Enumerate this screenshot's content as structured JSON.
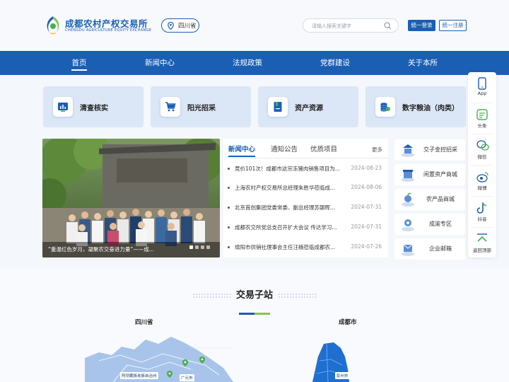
{
  "header": {
    "logo_cn": "成都农村产权交易所",
    "logo_en": "CHENGDU AGRICULTURE EQUITY EXCHANGE",
    "region": "四川省",
    "search_placeholder": "请输入搜索关键字",
    "login_label": "统一登录",
    "register_label": "统一注册"
  },
  "nav": {
    "items": [
      {
        "label": "首页",
        "active": true
      },
      {
        "label": "新闻中心"
      },
      {
        "label": "法规政策"
      },
      {
        "label": "党群建设"
      },
      {
        "label": "关于本所"
      }
    ]
  },
  "features": [
    {
      "label": "清查核实",
      "icon": "chart-icon"
    },
    {
      "label": "阳光招采",
      "icon": "cart-icon"
    },
    {
      "label": "资产资源",
      "icon": "book-icon"
    },
    {
      "label": "数字粮油（肉类）",
      "icon": "coins-icon"
    }
  ],
  "banner": {
    "caption": "“重温红色岁月，凝聚农交奋进力量”——成..."
  },
  "news": {
    "tabs": [
      "新闻中心",
      "通知公告",
      "优质项目"
    ],
    "more": "更多",
    "items": [
      {
        "title": "竞价101次！成都市这宗冻猪肉销售项目为...",
        "date": "2024-08-23"
      },
      {
        "title": "上海农村产权交易所总经理朱胜华莅临成...",
        "date": "2024-08-06"
      },
      {
        "title": "北京首创集团党委常委、副总经理苏朝晖...",
        "date": "2024-07-31"
      },
      {
        "title": "成都农交所党总支召开扩大会议 传达学习...",
        "date": "2024-07-31"
      },
      {
        "title": "绵阳市供销社理事会主任汪楠莅临成都农...",
        "date": "2024-07-26"
      }
    ]
  },
  "quicklinks": [
    {
      "label": "交子金控招采"
    },
    {
      "label": "闲置资产商城"
    },
    {
      "label": "农产品商城"
    },
    {
      "label": "成渝专区"
    },
    {
      "label": "企业邮箱"
    }
  ],
  "float": {
    "items": [
      {
        "label": "App"
      },
      {
        "label": "头条"
      },
      {
        "label": "微信"
      },
      {
        "label": "微博"
      },
      {
        "label": "抖音"
      },
      {
        "label": "返回顶部"
      }
    ]
  },
  "stations": {
    "title": "交易子站",
    "left_label": "四川省",
    "right_label": "成都市",
    "map_labels": [
      "阿坝藏族羌族自治州",
      "广元市",
      "彭州市"
    ]
  },
  "colors": {
    "brand": "#1a5fb4",
    "accent_green": "#4caf50",
    "accent_yellow": "#f5b800"
  }
}
